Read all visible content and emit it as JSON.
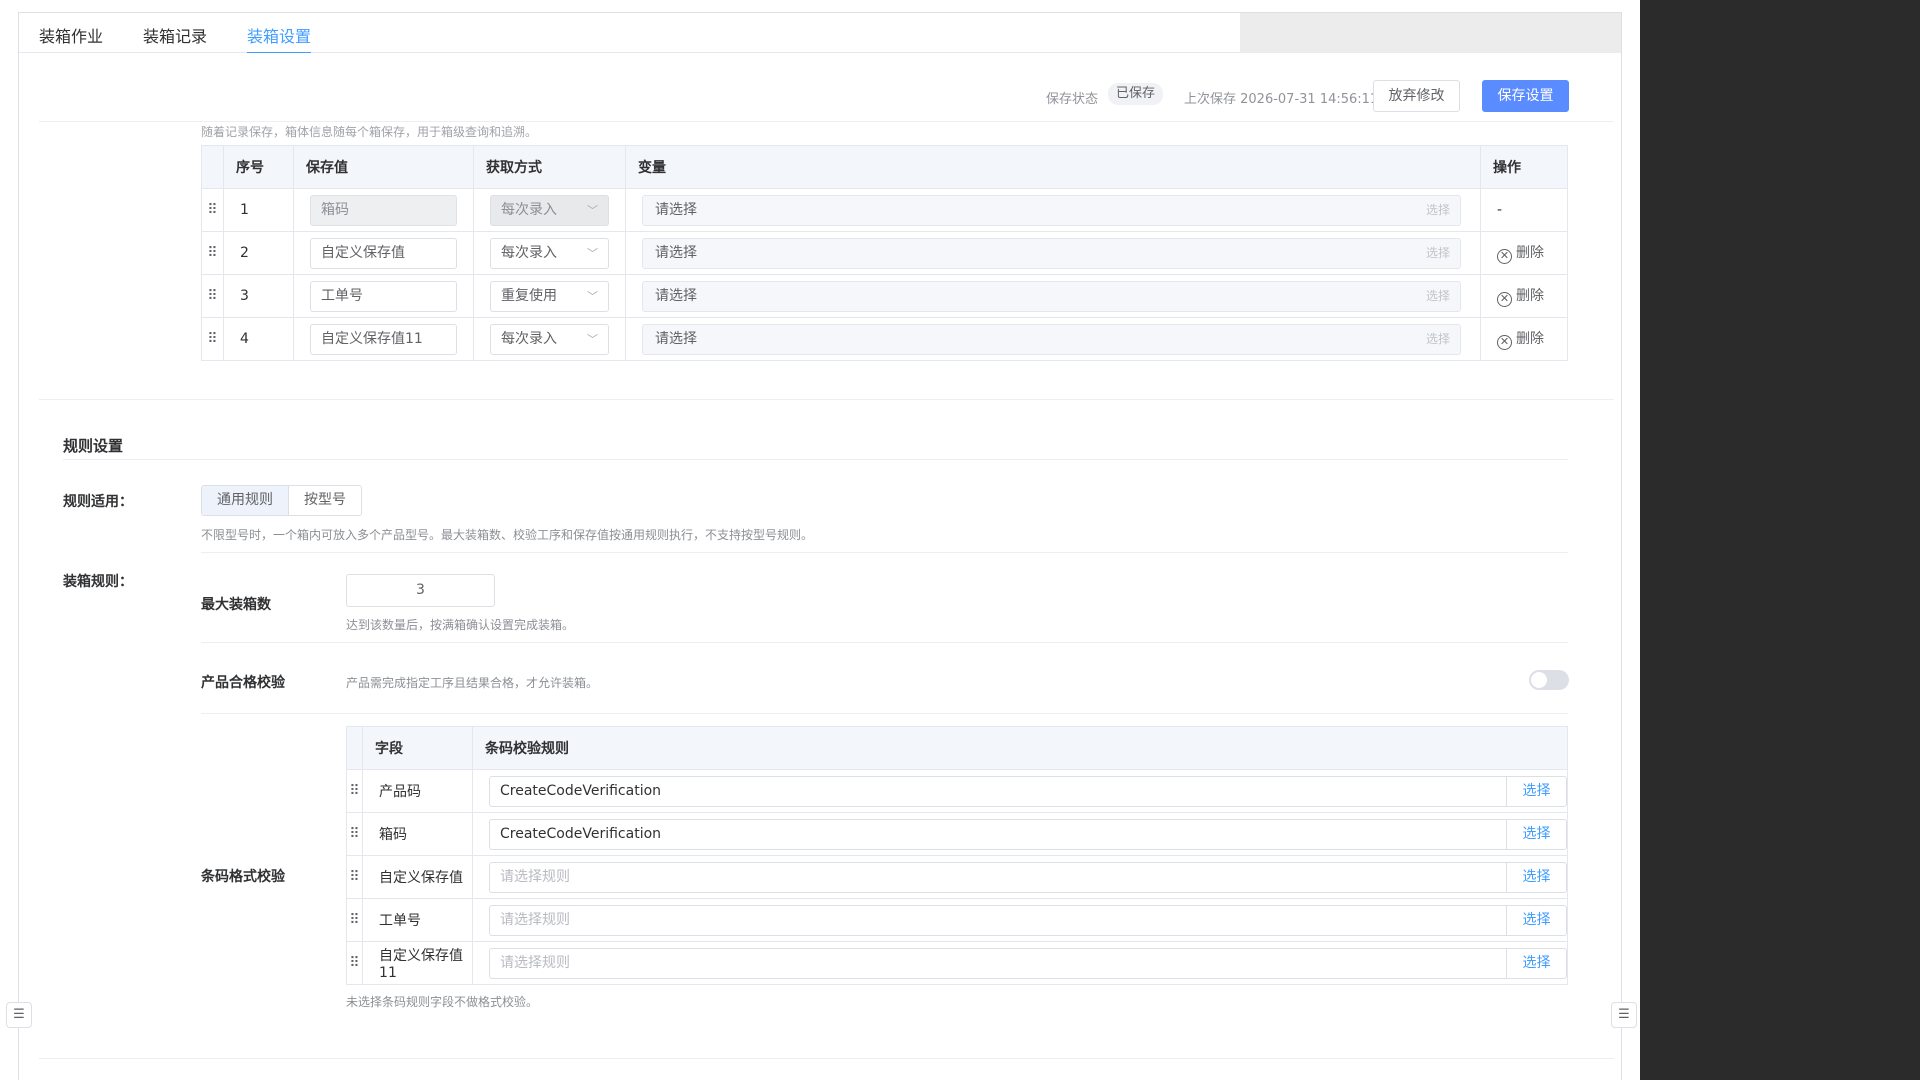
{
  "tabs": [
    {
      "label": "装箱作业"
    },
    {
      "label": "装箱记录"
    },
    {
      "label": "装箱设置"
    }
  ],
  "header": {
    "status_label": "保存状态",
    "status_value": "已保存",
    "last_save": "上次保存 2026-07-31 14:56:11",
    "discard_label": "放弃修改",
    "save_label": "保存设置"
  },
  "variables": {
    "desc": "随着记录保存，箱体信息随每个箱保存，用于箱级查询和追溯。",
    "columns": [
      "序号",
      "保存值",
      "获取方式",
      "变量",
      "操作"
    ],
    "rows": [
      {
        "index": "1",
        "value": "箱码",
        "mode": "每次录入",
        "variable": "请选择",
        "pick": "选择",
        "action": "-"
      },
      {
        "index": "2",
        "value": "自定义保存值",
        "mode": "每次录入",
        "variable": "请选择",
        "pick": "选择",
        "action": "删除"
      },
      {
        "index": "3",
        "value": "工单号",
        "mode": "重复使用",
        "variable": "请选择",
        "pick": "选择",
        "action": "删除"
      },
      {
        "index": "4",
        "value": "自定义保存值11",
        "mode": "每次录入",
        "variable": "请选择",
        "pick": "选择",
        "action": "删除"
      }
    ]
  },
  "rules": {
    "title": "规则设置",
    "apply_label": "规则适用：",
    "apply_options": [
      "通用规则",
      "按型号"
    ],
    "apply_hint": "不限型号时，一个箱内可放入多个产品型号。最大装箱数、校验工序和保存值按通用规则执行，不支持按型号规则。",
    "packing_label": "装箱规则：",
    "max_label": "最大装箱数",
    "max_value": "3",
    "max_hint": "达到该数量后，按满箱确认设置完成装箱。",
    "qc_label": "产品合格校验",
    "qc_hint": "产品需完成指定工序且结果合格，才允许装箱。",
    "qc_enabled": false,
    "barcode_label": "条码格式校验",
    "barcode_columns": [
      "字段",
      "条码校验规则"
    ],
    "barcode_rows": [
      {
        "field": "产品码",
        "rule": "CreateCodeVerification",
        "btn": "选择"
      },
      {
        "field": "箱码",
        "rule": "CreateCodeVerification",
        "btn": "选择"
      },
      {
        "field": "自定义保存值",
        "rule": "请选择规则",
        "btn": "选择"
      },
      {
        "field": "工单号",
        "rule": "请选择规则",
        "btn": "选择"
      },
      {
        "field": "自定义保存值11",
        "rule": "请选择规则",
        "btn": "选择"
      }
    ],
    "barcode_hint": "未选择条码规则字段不做格式校验。"
  },
  "colors": {
    "accent": "#409eff",
    "primary_button": "#5b8cff",
    "right_panel": "#2b2b2b"
  },
  "icons": [
    "drag-handle-icon",
    "chevron-down-icon",
    "close-circle-icon",
    "list-collapse-icon"
  ]
}
